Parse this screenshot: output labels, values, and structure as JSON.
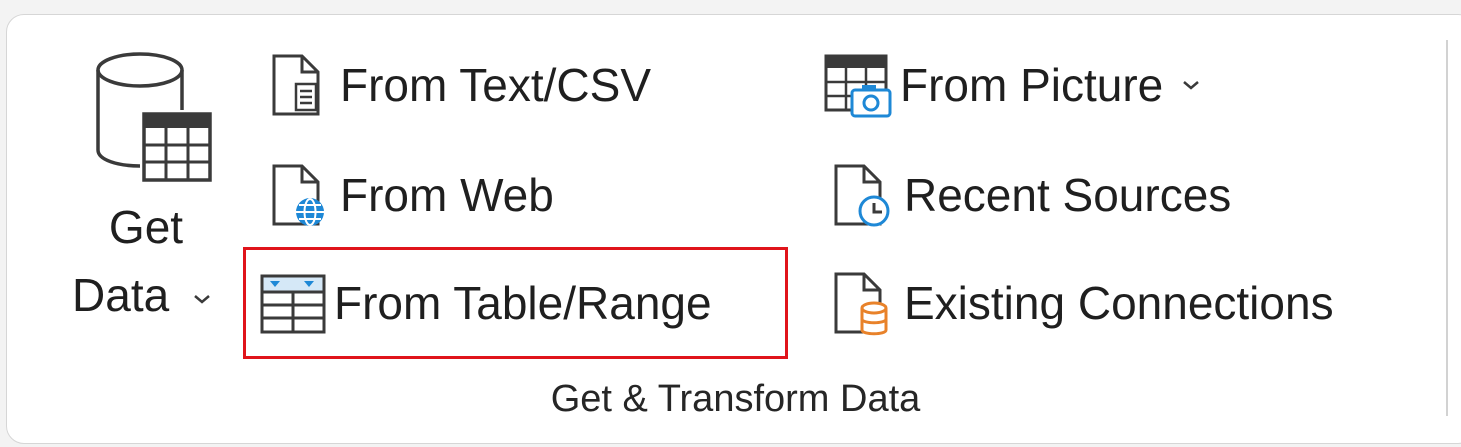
{
  "group": {
    "label": "Get & Transform Data"
  },
  "get_data": {
    "label_line1": "Get",
    "label_line2": "Data",
    "icon": "database-table-icon"
  },
  "commands": {
    "from_text_csv": {
      "label": "From Text/CSV",
      "icon": "text-file-icon"
    },
    "from_web": {
      "label": "From Web",
      "icon": "web-file-globe-icon"
    },
    "from_table_range": {
      "label": "From Table/Range",
      "icon": "table-range-icon",
      "highlighted": true
    },
    "from_picture": {
      "label": "From Picture",
      "icon": "picture-camera-table-icon",
      "has_dropdown": true
    },
    "recent_sources": {
      "label": "Recent Sources",
      "icon": "recent-file-clock-icon"
    },
    "existing_connections": {
      "label": "Existing Connections",
      "icon": "connection-file-cylinder-icon"
    }
  },
  "colors": {
    "highlight": "#e0141b",
    "icon_blue": "#1e88d6",
    "icon_orange": "#e8822a",
    "icon_gray": "#3a3a3a"
  }
}
